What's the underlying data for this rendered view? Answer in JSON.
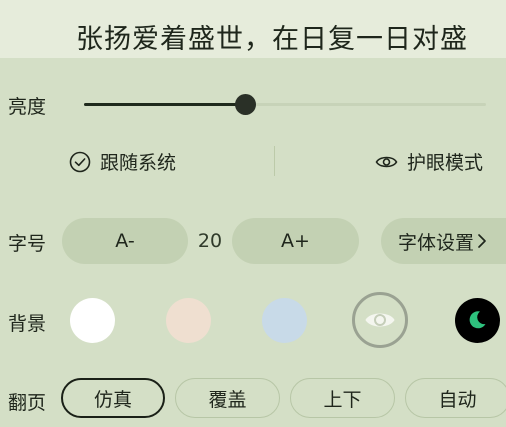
{
  "reading_text": "张扬爱着盛世，在日复一日对盛",
  "brightness": {
    "label": "亮度",
    "level": 0.4
  },
  "display_options": {
    "follow_system": "跟随系统",
    "eye_care": "护眼模式"
  },
  "font_size": {
    "label": "字号",
    "decrease": "A-",
    "value": "20",
    "increase": "A+",
    "settings": "字体设置"
  },
  "background": {
    "label": "背景",
    "swatches": [
      {
        "name": "white",
        "color": "#ffffff"
      },
      {
        "name": "pink",
        "color": "#efdfd0"
      },
      {
        "name": "blue",
        "color": "#c8dae8"
      },
      {
        "name": "green-selected",
        "color": "#d4dfc6",
        "icon": "eye-icon",
        "selected": true
      },
      {
        "name": "night",
        "color": "#000000",
        "icon": "moon-icon"
      }
    ]
  },
  "page_turn": {
    "label": "翻页",
    "options": [
      "仿真",
      "覆盖",
      "上下",
      "自动"
    ],
    "selected": "仿真"
  }
}
